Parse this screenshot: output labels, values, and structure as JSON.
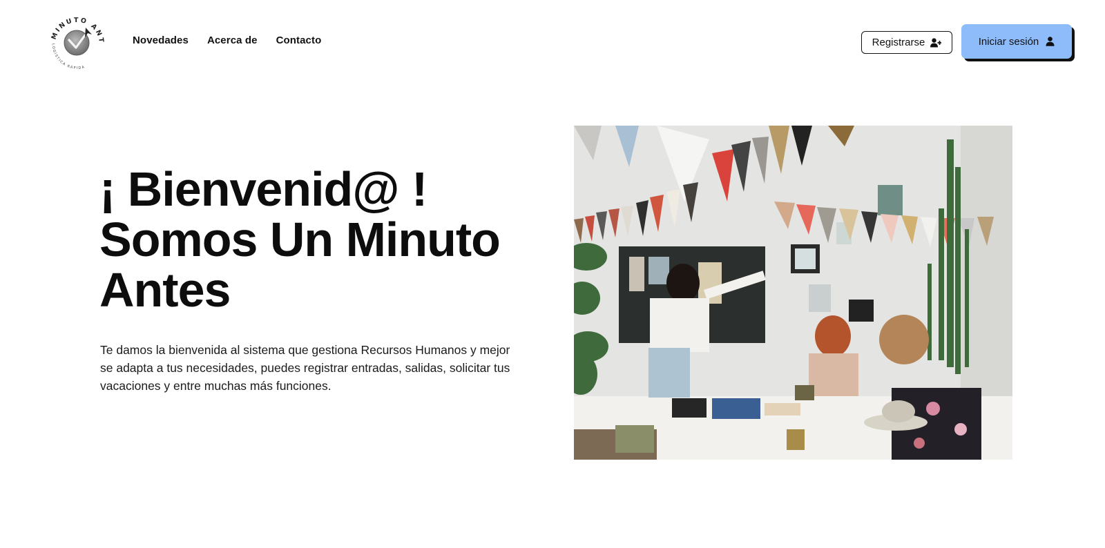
{
  "brand": {
    "name": "MINUTO ANTES",
    "tagline": "LOGÍSTICA RÁPIDA"
  },
  "nav": {
    "items": [
      {
        "label": "Novedades"
      },
      {
        "label": "Acerca de"
      },
      {
        "label": "Contacto"
      }
    ]
  },
  "auth": {
    "register_label": "Registrarse",
    "register_icon": "user-plus-icon",
    "login_label": "Iniciar sesión",
    "login_icon": "user-icon"
  },
  "hero": {
    "title_lines": [
      "¡ Bienvenid@ !",
      "Somos Un Minuto",
      "Antes"
    ],
    "description": "Te damos la bienvenida al sistema que gestiona Recursos Humanos y mejor se adapta a tus necesidades, puedes registrar entradas, salidas, solicitar tus vacaciones y entre muchas más funciones."
  },
  "colors": {
    "login_button": "#8ebcfb",
    "text": "#111111",
    "background": "#ffffff"
  }
}
